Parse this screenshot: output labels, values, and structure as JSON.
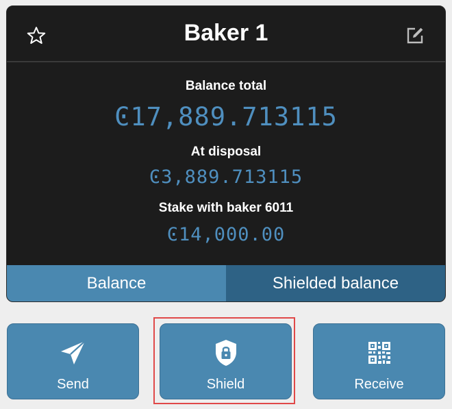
{
  "account": {
    "title": "Baker 1"
  },
  "balances": {
    "total_label": "Balance total",
    "total_amount": "Ͼ17,889.713115",
    "disposal_label": "At disposal",
    "disposal_amount": "Ͼ3,889.713115",
    "stake_label": "Stake with baker 6011",
    "stake_amount": "Ͼ14,000.00"
  },
  "tabs": [
    {
      "label": "Balance",
      "active": true
    },
    {
      "label": "Shielded balance",
      "active": false
    }
  ],
  "actions": [
    {
      "label": "Send",
      "icon": "send-icon"
    },
    {
      "label": "Shield",
      "icon": "shield-lock-icon"
    },
    {
      "label": "Receive",
      "icon": "qr-code-icon"
    }
  ],
  "icons": {
    "favorite": "star-icon",
    "edit": "edit-icon"
  },
  "colors": {
    "card_background": "#1c1c1c",
    "amount_text": "#4f8fbf",
    "button_background": "#4a88b0",
    "tab_active": "#4a88b0",
    "tab_inactive": "#2e6285",
    "highlight": "#e04848"
  }
}
